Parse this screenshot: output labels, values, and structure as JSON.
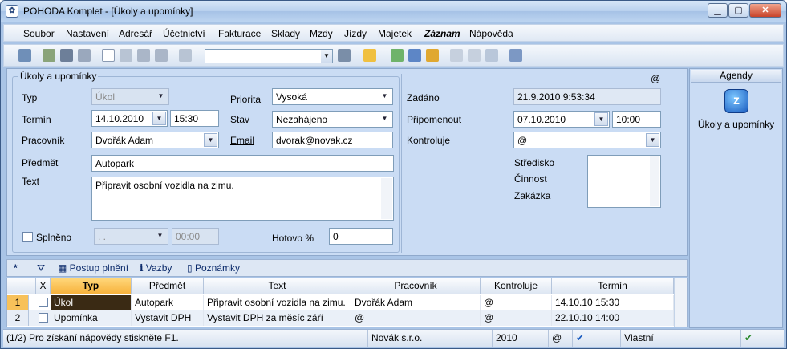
{
  "window": {
    "title": "POHODA Komplet - [Úkoly a upomínky]",
    "app_icon": "pohoda-app-icon"
  },
  "menu": [
    "Soubor",
    "Nastavení",
    "Adresář",
    "Účetnictví",
    "Fakturace",
    "Sklady",
    "Mzdy",
    "Jízdy",
    "Majetek",
    "Záznam",
    "Nápověda"
  ],
  "form": {
    "group_title": "Úkoly a upomínky",
    "at_sign": "@",
    "typ": {
      "label": "Typ",
      "value": "Úkol"
    },
    "termin": {
      "label": "Termín",
      "date": "14.10.2010",
      "time": "15:30"
    },
    "pracovnik": {
      "label": "Pracovník",
      "value": "Dvořák Adam"
    },
    "predmet": {
      "label": "Předmět",
      "value": "Autopark"
    },
    "text": {
      "label": "Text",
      "value": "Připravit osobní vozidla na zimu."
    },
    "priorita": {
      "label": "Priorita",
      "value": "Vysoká"
    },
    "stav": {
      "label": "Stav",
      "value": "Nezahájeno"
    },
    "email": {
      "label": "Email",
      "value": "dvorak@novak.cz"
    },
    "splneno": {
      "label": "Splněno",
      "date": ". .",
      "time": "00:00"
    },
    "hotovo": {
      "label": "Hotovo %",
      "value": "0"
    },
    "zadano": {
      "label": "Zadáno",
      "value": "21.9.2010 9:53:34"
    },
    "pripomenout": {
      "label": "Připomenout",
      "date": "07.10.2010",
      "time": "10:00"
    },
    "kontroluje": {
      "label": "Kontroluje",
      "value": "@"
    },
    "stredisko": {
      "label": "Středisko"
    },
    "cinnost": {
      "label": "Činnost"
    },
    "zakazka": {
      "label": "Zakázka"
    }
  },
  "agendy": {
    "header": "Agendy",
    "item": "Úkoly a upomínky"
  },
  "tabs": {
    "star": "*",
    "items": [
      "Postup plnění",
      "Vazby",
      "Poznámky"
    ]
  },
  "grid": {
    "headers": [
      "X",
      "Typ",
      "Předmět",
      "Text",
      "Pracovník",
      "Kontroluje",
      "Termín"
    ],
    "rows": [
      {
        "n": "1",
        "typ": "Úkol",
        "predmet": "Autopark",
        "text": "Připravit osobní vozidla na zimu.",
        "pracovnik": "Dvořák Adam",
        "kontroluje": "@",
        "termin": "14.10.10 15:30"
      },
      {
        "n": "2",
        "typ": "Upomínka",
        "predmet": "Vystavit DPH",
        "text": "Vystavit DPH za měsíc září",
        "pracovnik": "@",
        "kontroluje": "@",
        "termin": "22.10.10 14:00"
      }
    ]
  },
  "status": {
    "help": "(1/2) Pro získání nápovědy stiskněte F1.",
    "company": "Novák s.r.o.",
    "year": "2010",
    "at": "@",
    "owner": "Vlastní"
  }
}
